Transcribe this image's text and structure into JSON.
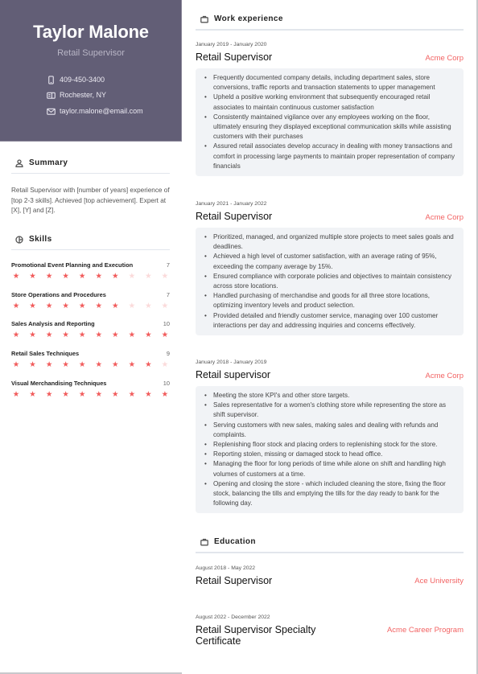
{
  "profile": {
    "name": "Taylor Malone",
    "role": "Retail Supervisor",
    "contacts": [
      {
        "icon": "phone-icon",
        "value": "409-450-3400"
      },
      {
        "icon": "address-card-icon",
        "value": "Rochester, NY"
      },
      {
        "icon": "envelope-icon",
        "value": "taylor.malone@email.com"
      }
    ]
  },
  "summary": {
    "heading": "Summary",
    "icon": "user-icon",
    "text": "Retail Supervisor with [number of years] experience of [top 2-3 skills]. Achieved [top achievement]. Expert at [X], [Y] and [Z]."
  },
  "skills": {
    "heading": "Skills",
    "icon": "pie-chart-icon",
    "max_rating": 10,
    "accent_color": "#f15b5b",
    "items": [
      {
        "name": "Promotional Event Planning and Execution",
        "rating": 7
      },
      {
        "name": "Store Operations and Procedures",
        "rating": 7
      },
      {
        "name": "Sales Analysis and Reporting",
        "rating": 10
      },
      {
        "name": "Retail Sales Techniques",
        "rating": 9
      },
      {
        "name": "Visual Merchandising Techniques",
        "rating": 10
      }
    ]
  },
  "work": {
    "heading": "Work experience",
    "icon": "briefcase-icon",
    "jobs": [
      {
        "dates": "January 2019 - January 2020",
        "title": "Retail Supervisor",
        "company": "Acme Corp",
        "bullets": [
          "Frequently documented company details, including department sales, store conversions, traffic reports and transaction statements to upper management",
          "Upheld a positive working environment that subsequently encouraged retail associates to maintain continuous customer satisfaction",
          "Consistently maintained vigilance over any employees working on the floor, ultimately ensuring they displayed exceptional communication skills while assisting customers with their purchases",
          "Assured retail associates develop accuracy in dealing with money transactions and comfort in processing large payments to maintain proper representation of company financials"
        ]
      },
      {
        "dates": "January 2021 - January 2022",
        "title": "Retail Supervisor",
        "company": "Acme Corp",
        "bullets": [
          "Prioritized, managed, and organized multiple store projects to meet sales goals and deadlines.",
          "Achieved a high level of customer satisfaction, with an average rating of 95%, exceeding the company average by 15%.",
          "Ensured compliance with corporate policies and objectives to maintain consistency across store locations.",
          "Handled purchasing of merchandise and goods for all three store locations, optimizing inventory levels and product selection.",
          "Provided detailed and friendly customer service, managing over 100 customer interactions per day and addressing inquiries and concerns effectively."
        ]
      },
      {
        "dates": "January 2018 - January 2019",
        "title": "Retail supervisor",
        "company": "Acme Corp",
        "bullets": [
          "Meeting the store KPI's and other store targets.",
          "Sales representative for a women's clothing store while representing the store as shift supervisor.",
          "Serving customers with new sales, making sales and dealing with refunds and complaints.",
          "Replenishing floor stock and placing orders to replenishing stock for the store.",
          "Reporting stolen, missing or damaged stock to head office.",
          "Managing the floor for long periods of time while alone on shift and handling high volumes of customers at a time.",
          "Opening and closing the store - which included cleaning the store, fixing the floor stock, balancing the tills and emptying the tills for the day ready to bank for the following day."
        ]
      }
    ]
  },
  "education": {
    "heading": "Education",
    "icon": "briefcase-icon",
    "entries": [
      {
        "dates": "August 2018 - May 2022",
        "title": "Retail Supervisor",
        "school": "Ace University"
      },
      {
        "dates": "August 2022 - December 2022",
        "title": "Retail Supervisor Specialty Certificate",
        "school": "Acme Career Program"
      }
    ]
  },
  "colors": {
    "header_bg": "#625e76",
    "accent": "#f26363",
    "bullet_box_bg": "#f1f3f6"
  }
}
